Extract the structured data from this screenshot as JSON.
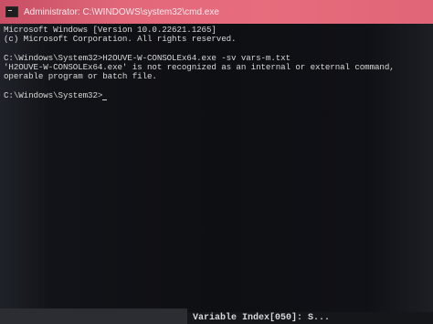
{
  "window": {
    "title": "Administrator: C:\\WINDOWS\\system32\\cmd.exe"
  },
  "console": {
    "lines": [
      "Microsoft Windows [Version 10.0.22621.1265]",
      "(c) Microsoft Corporation. All rights reserved.",
      "",
      "C:\\Windows\\System32>H2OUVE-W-CONSOLEx64.exe -sv vars-m.txt",
      "'H2OUVE-W-CONSOLEx64.exe' is not recognized as an internal or external command,",
      "operable program or batch file.",
      "",
      "C:\\Windows\\System32>"
    ]
  },
  "bottom_bar": {
    "text": "Variable Index[050]: S..."
  }
}
